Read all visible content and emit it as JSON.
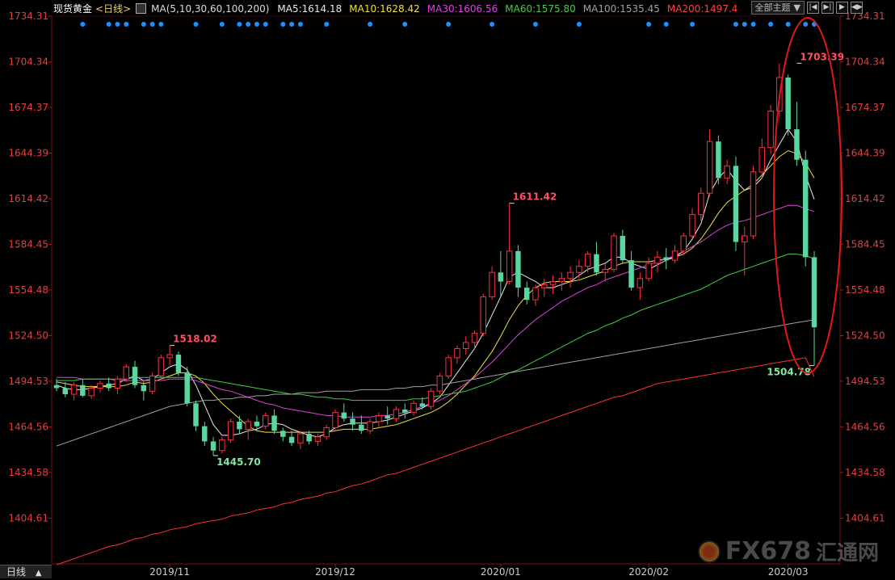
{
  "header": {
    "instrument": "现货黄金",
    "period_tag": "<日线>",
    "ma_icon": "ma-settings-icon",
    "ma_params": "MA(5,10,30,60,100,200)",
    "ma_values": [
      {
        "label": "MA5:1614.18",
        "color": "#e8e8e8"
      },
      {
        "label": "MA10:1628.42",
        "color": "#f0e040"
      },
      {
        "label": "MA30:1606.56",
        "color": "#e040e0"
      },
      {
        "label": "MA60:1575.80",
        "color": "#40d040"
      },
      {
        "label": "MA100:1535.45",
        "color": "#a0a0a0"
      },
      {
        "label": "MA200:1497.4",
        "color": "#ff4040"
      }
    ]
  },
  "toolbar": {
    "theme_label": "全部主题",
    "theme_arrow": "▼",
    "buttons": [
      "|◀",
      "▶|",
      "▶",
      "◀▶"
    ]
  },
  "period_tab": {
    "label": "日线",
    "arrow": "▲"
  },
  "watermark": {
    "text": "FX678",
    "subtext": "汇通网"
  },
  "chart_data": {
    "type": "candlestick",
    "y_ticks": [
      1734.31,
      1704.34,
      1674.37,
      1644.39,
      1614.42,
      1584.45,
      1554.48,
      1524.5,
      1494.53,
      1464.56,
      1434.58,
      1404.61
    ],
    "x_ticks": [
      "2019/11",
      "2019/12",
      "2020/01",
      "2020/02",
      "2020/03"
    ],
    "ylim": [
      1374.6,
      1734.31
    ],
    "annotations": [
      {
        "label": "1518.02",
        "value": 1518.02,
        "color": "#ff5060"
      },
      {
        "label": "1445.70",
        "value": 1445.7,
        "color": "#7ee8a0"
      },
      {
        "label": "1611.42",
        "value": 1611.42,
        "color": "#ff5060"
      },
      {
        "label": "1703.39",
        "value": 1703.39,
        "color": "#ff5060"
      },
      {
        "label": "1504.78",
        "value": 1504.78,
        "color": "#7ee8a0"
      }
    ],
    "series_colors": {
      "up": "#ff3040",
      "down": "#5ad6a0"
    },
    "candles": [
      [
        1492,
        1496,
        1488,
        1490
      ],
      [
        1490,
        1494,
        1484,
        1486
      ],
      [
        1486,
        1494,
        1482,
        1492
      ],
      [
        1492,
        1496,
        1484,
        1485
      ],
      [
        1485,
        1492,
        1483,
        1490
      ],
      [
        1490,
        1495,
        1487,
        1493
      ],
      [
        1493,
        1497,
        1488,
        1490
      ],
      [
        1490,
        1498,
        1486,
        1496
      ],
      [
        1496,
        1506,
        1494,
        1504
      ],
      [
        1504,
        1508,
        1490,
        1492
      ],
      [
        1492,
        1495,
        1482,
        1488
      ],
      [
        1488,
        1500,
        1486,
        1498
      ],
      [
        1498,
        1512,
        1496,
        1510
      ],
      [
        1510,
        1518.02,
        1505,
        1512
      ],
      [
        1512,
        1514,
        1498,
        1500
      ],
      [
        1500,
        1504,
        1478,
        1480
      ],
      [
        1480,
        1482,
        1462,
        1465
      ],
      [
        1465,
        1468,
        1452,
        1455
      ],
      [
        1455,
        1458,
        1445.7,
        1449
      ],
      [
        1449,
        1458,
        1447,
        1456
      ],
      [
        1456,
        1470,
        1454,
        1468
      ],
      [
        1468,
        1472,
        1460,
        1463
      ],
      [
        1463,
        1470,
        1456,
        1468
      ],
      [
        1468,
        1472,
        1462,
        1465
      ],
      [
        1465,
        1474,
        1463,
        1472
      ],
      [
        1472,
        1476,
        1460,
        1462
      ],
      [
        1462,
        1464,
        1455,
        1458
      ],
      [
        1458,
        1462,
        1452,
        1454
      ],
      [
        1454,
        1462,
        1450,
        1460
      ],
      [
        1460,
        1462,
        1453,
        1455
      ],
      [
        1455,
        1460,
        1452,
        1458
      ],
      [
        1458,
        1466,
        1456,
        1464
      ],
      [
        1464,
        1476,
        1462,
        1474
      ],
      [
        1474,
        1480,
        1468,
        1470
      ],
      [
        1470,
        1474,
        1462,
        1466
      ],
      [
        1466,
        1472,
        1460,
        1462
      ],
      [
        1462,
        1470,
        1460,
        1468
      ],
      [
        1468,
        1474,
        1464,
        1472
      ],
      [
        1472,
        1478,
        1466,
        1470
      ],
      [
        1470,
        1478,
        1468,
        1476
      ],
      [
        1476,
        1480,
        1470,
        1474
      ],
      [
        1474,
        1482,
        1472,
        1480
      ],
      [
        1480,
        1484,
        1476,
        1478
      ],
      [
        1478,
        1490,
        1476,
        1488
      ],
      [
        1488,
        1500,
        1486,
        1498
      ],
      [
        1498,
        1512,
        1496,
        1510
      ],
      [
        1510,
        1518,
        1506,
        1516
      ],
      [
        1516,
        1524,
        1512,
        1520
      ],
      [
        1520,
        1528,
        1516,
        1526
      ],
      [
        1526,
        1552,
        1524,
        1550
      ],
      [
        1550,
        1570,
        1548,
        1566
      ],
      [
        1566,
        1580,
        1550,
        1560
      ],
      [
        1560,
        1611.42,
        1558,
        1580
      ],
      [
        1580,
        1584,
        1550,
        1556
      ],
      [
        1556,
        1560,
        1545,
        1548
      ],
      [
        1548,
        1558,
        1544,
        1556
      ],
      [
        1556,
        1562,
        1550,
        1558
      ],
      [
        1558,
        1564,
        1552,
        1560
      ],
      [
        1560,
        1566,
        1554,
        1562
      ],
      [
        1562,
        1570,
        1556,
        1566
      ],
      [
        1566,
        1574,
        1562,
        1570
      ],
      [
        1570,
        1580,
        1566,
        1578
      ],
      [
        1578,
        1586,
        1564,
        1566
      ],
      [
        1566,
        1572,
        1560,
        1568
      ],
      [
        1568,
        1592,
        1566,
        1590
      ],
      [
        1590,
        1594,
        1572,
        1574
      ],
      [
        1574,
        1580,
        1554,
        1556
      ],
      [
        1556,
        1566,
        1548,
        1562
      ],
      [
        1562,
        1576,
        1560,
        1572
      ],
      [
        1572,
        1580,
        1566,
        1576
      ],
      [
        1576,
        1582,
        1568,
        1574
      ],
      [
        1574,
        1584,
        1572,
        1580
      ],
      [
        1580,
        1592,
        1578,
        1590
      ],
      [
        1590,
        1608,
        1588,
        1604
      ],
      [
        1604,
        1622,
        1600,
        1618
      ],
      [
        1618,
        1660,
        1616,
        1652
      ],
      [
        1652,
        1656,
        1624,
        1628
      ],
      [
        1628,
        1640,
        1624,
        1636
      ],
      [
        1636,
        1642,
        1580,
        1586
      ],
      [
        1586,
        1596,
        1564,
        1590
      ],
      [
        1590,
        1636,
        1588,
        1632
      ],
      [
        1632,
        1654,
        1628,
        1648
      ],
      [
        1648,
        1676,
        1644,
        1672
      ],
      [
        1672,
        1703.39,
        1668,
        1694
      ],
      [
        1694,
        1696,
        1656,
        1660
      ],
      [
        1660,
        1678,
        1636,
        1640
      ],
      [
        1640,
        1646,
        1570,
        1576
      ],
      [
        1576,
        1580,
        1504.78,
        1530
      ]
    ],
    "ma_lines": {
      "ma5": [
        1492,
        1490,
        1489,
        1489,
        1490,
        1491,
        1492,
        1493,
        1496,
        1498,
        1495,
        1496,
        1500,
        1504,
        1506,
        1502,
        1492,
        1479,
        1466,
        1459,
        1459,
        1460,
        1462,
        1463,
        1466,
        1467,
        1466,
        1463,
        1461,
        1459,
        1458,
        1460,
        1464,
        1466,
        1467,
        1467,
        1467,
        1468,
        1469,
        1471,
        1473,
        1475,
        1477,
        1480,
        1484,
        1492,
        1500,
        1508,
        1516,
        1526,
        1538,
        1550,
        1563,
        1566,
        1563,
        1560,
        1556,
        1556,
        1558,
        1560,
        1564,
        1568,
        1570,
        1572,
        1576,
        1576,
        1572,
        1570,
        1568,
        1571,
        1574,
        1576,
        1580,
        1588,
        1598,
        1618,
        1628,
        1634,
        1626,
        1620,
        1622,
        1628,
        1640,
        1650,
        1660,
        1652,
        1630,
        1614
      ],
      "ma10": [
        1494,
        1493,
        1492,
        1491,
        1491,
        1491,
        1491,
        1491,
        1492,
        1494,
        1493,
        1494,
        1496,
        1498,
        1500,
        1500,
        1498,
        1493,
        1486,
        1480,
        1475,
        1470,
        1465,
        1462,
        1461,
        1461,
        1461,
        1461,
        1461,
        1461,
        1461,
        1461,
        1462,
        1463,
        1463,
        1463,
        1463,
        1464,
        1465,
        1466,
        1468,
        1470,
        1472,
        1474,
        1477,
        1481,
        1486,
        1492,
        1498,
        1506,
        1514,
        1524,
        1535,
        1544,
        1551,
        1556,
        1559,
        1560,
        1560,
        1560,
        1561,
        1563,
        1565,
        1567,
        1570,
        1572,
        1573,
        1573,
        1573,
        1574,
        1575,
        1576,
        1578,
        1582,
        1588,
        1596,
        1605,
        1612,
        1616,
        1620,
        1624,
        1630,
        1636,
        1642,
        1646,
        1644,
        1638,
        1628
      ],
      "ma30": [
        1497,
        1497,
        1497,
        1496,
        1496,
        1496,
        1496,
        1495,
        1495,
        1495,
        1495,
        1495,
        1495,
        1496,
        1496,
        1496,
        1495,
        1493,
        1491,
        1489,
        1488,
        1486,
        1484,
        1482,
        1480,
        1479,
        1477,
        1476,
        1475,
        1474,
        1473,
        1472,
        1472,
        1471,
        1471,
        1471,
        1471,
        1472,
        1472,
        1473,
        1474,
        1476,
        1478,
        1480,
        1482,
        1485,
        1489,
        1493,
        1497,
        1502,
        1507,
        1513,
        1519,
        1525,
        1530,
        1535,
        1539,
        1543,
        1547,
        1550,
        1553,
        1556,
        1558,
        1561,
        1563,
        1565,
        1567,
        1569,
        1571,
        1573,
        1575,
        1577,
        1580,
        1583,
        1586,
        1590,
        1594,
        1597,
        1599,
        1600,
        1602,
        1604,
        1606,
        1608,
        1610,
        1610,
        1608,
        1606
      ],
      "ma60": [
        1495,
        1495,
        1495,
        1496,
        1496,
        1496,
        1496,
        1496,
        1496,
        1497,
        1497,
        1497,
        1497,
        1497,
        1497,
        1497,
        1497,
        1496,
        1495,
        1494,
        1493,
        1492,
        1491,
        1490,
        1489,
        1488,
        1487,
        1486,
        1486,
        1485,
        1484,
        1484,
        1483,
        1483,
        1482,
        1482,
        1482,
        1482,
        1482,
        1482,
        1482,
        1483,
        1483,
        1484,
        1485,
        1486,
        1487,
        1488,
        1490,
        1492,
        1494,
        1497,
        1500,
        1502,
        1505,
        1508,
        1511,
        1514,
        1517,
        1520,
        1523,
        1526,
        1528,
        1531,
        1533,
        1536,
        1538,
        1541,
        1543,
        1545,
        1547,
        1549,
        1551,
        1553,
        1555,
        1558,
        1561,
        1564,
        1566,
        1568,
        1570,
        1572,
        1574,
        1576,
        1578,
        1578,
        1577,
        1575
      ],
      "ma100": [
        1452,
        1454,
        1456,
        1458,
        1460,
        1462,
        1464,
        1466,
        1468,
        1470,
        1472,
        1474,
        1476,
        1478,
        1479,
        1480,
        1481,
        1482,
        1482,
        1483,
        1483,
        1484,
        1484,
        1485,
        1485,
        1486,
        1486,
        1486,
        1487,
        1487,
        1487,
        1488,
        1488,
        1488,
        1488,
        1489,
        1489,
        1489,
        1489,
        1490,
        1490,
        1491,
        1491,
        1492,
        1492,
        1493,
        1494,
        1495,
        1496,
        1497,
        1498,
        1499,
        1500,
        1501,
        1502,
        1503,
        1504,
        1505,
        1506,
        1507,
        1508,
        1509,
        1510,
        1511,
        1512,
        1513,
        1514,
        1515,
        1516,
        1517,
        1518,
        1519,
        1520,
        1521,
        1522,
        1523,
        1524,
        1525,
        1526,
        1527,
        1528,
        1529,
        1530,
        1531,
        1532,
        1533,
        1534,
        1535
      ],
      "ma200": [
        1374,
        1376,
        1378,
        1380,
        1382,
        1384,
        1386,
        1387,
        1389,
        1391,
        1392,
        1394,
        1395,
        1397,
        1398,
        1399,
        1401,
        1402,
        1403,
        1404,
        1406,
        1407,
        1408,
        1410,
        1411,
        1412,
        1414,
        1415,
        1417,
        1418,
        1419,
        1421,
        1422,
        1424,
        1426,
        1427,
        1429,
        1431,
        1433,
        1434,
        1436,
        1438,
        1440,
        1442,
        1444,
        1446,
        1448,
        1450,
        1452,
        1454,
        1456,
        1458,
        1460,
        1462,
        1464,
        1466,
        1468,
        1470,
        1472,
        1474,
        1476,
        1478,
        1480,
        1482,
        1484,
        1485,
        1487,
        1489,
        1491,
        1493,
        1494,
        1495,
        1496,
        1497,
        1498,
        1499,
        1500,
        1501,
        1502,
        1503,
        1504,
        1505,
        1506,
        1507,
        1508,
        1509,
        1510,
        1497.4
      ]
    },
    "event_dots": [
      3,
      6,
      7,
      8,
      10,
      11,
      12,
      16,
      19,
      21,
      22,
      23,
      24,
      26,
      27,
      28,
      31,
      36,
      40,
      45,
      50,
      55,
      60,
      68,
      70,
      73,
      78,
      79,
      80,
      82,
      84,
      86,
      87
    ]
  }
}
